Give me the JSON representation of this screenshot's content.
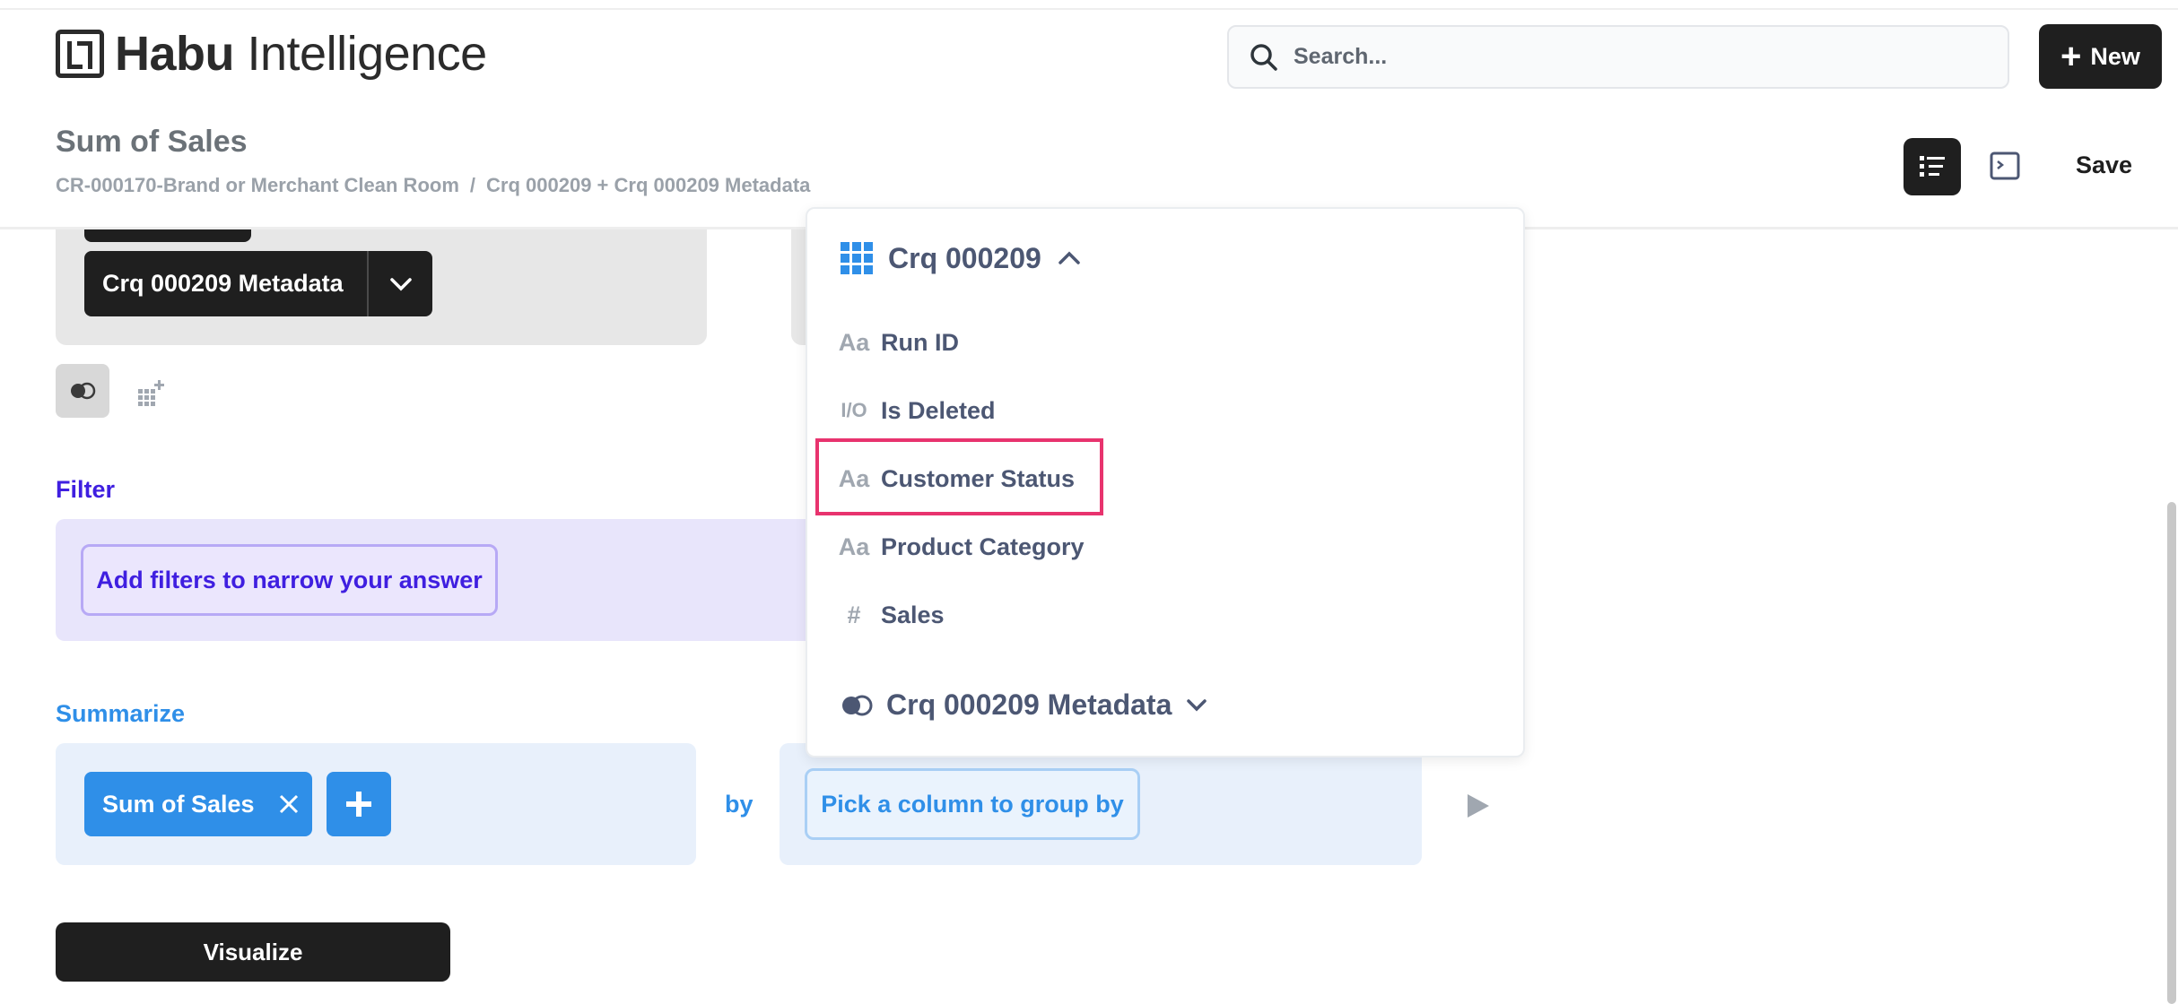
{
  "header": {
    "logo_bold": "Habu",
    "logo_light": "Intelligence",
    "search_placeholder": "Search...",
    "new_label": "New",
    "save_label": "Save"
  },
  "page": {
    "title": "Sum of Sales",
    "breadcrumb": [
      "CR-000170-Brand or Merchant Clean Room",
      "/",
      "Crq 000209 + Crq 000209 Metadata"
    ]
  },
  "data": {
    "joined_table": "Crq 000209 Metadata"
  },
  "filter": {
    "label": "Filter",
    "button": "Add filters to narrow your answer"
  },
  "summarize": {
    "label": "Summarize",
    "metric": "Sum of Sales",
    "by": "by",
    "group_button": "Pick a column to group by"
  },
  "visualize_label": "Visualize",
  "dropdown": {
    "table_name": "Crq 000209",
    "columns": [
      {
        "icon": "Aa",
        "label": "Run ID"
      },
      {
        "icon": "I/O",
        "label": "Is Deleted"
      },
      {
        "icon": "Aa",
        "label": "Customer Status"
      },
      {
        "icon": "Aa",
        "label": "Product Category"
      },
      {
        "icon": "#",
        "label": "Sales"
      }
    ],
    "joined_table_name": "Crq 000209 Metadata"
  },
  "colors": {
    "dark": "#1f1f1f",
    "filter_accent": "#3f1fe0",
    "summarize_accent": "#2f8fe8",
    "highlight": "#e8336e"
  }
}
